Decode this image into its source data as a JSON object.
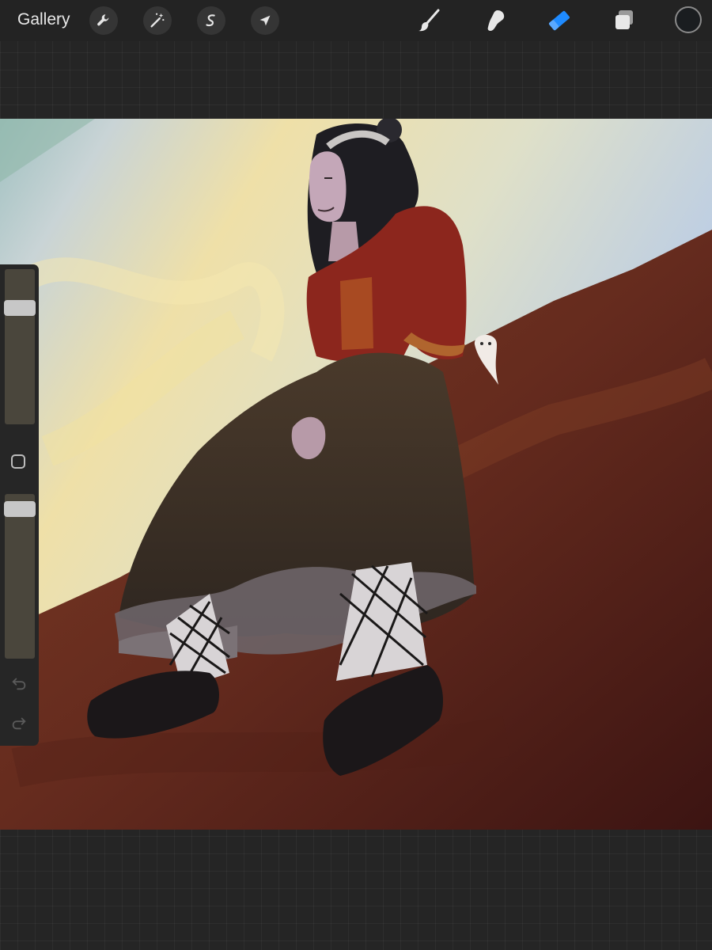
{
  "topbar": {
    "gallery_label": "Gallery",
    "actions": [
      "wrench-icon",
      "magic-wand-icon",
      "selection-icon",
      "transform-arrow-icon"
    ],
    "tools": [
      "brush-icon",
      "smudge-icon",
      "eraser-icon",
      "layers-icon"
    ],
    "active_tool": "eraser-icon",
    "active_color": "#1a1d20",
    "accent": "#1f8bff"
  },
  "sidebar": {
    "brush_size": 0.78,
    "opacity": 0.95,
    "buttons": [
      "modify-square-icon",
      "undo-icon",
      "redo-icon"
    ]
  },
  "canvas": {
    "sky_colors": [
      "#b7c8de",
      "#efe0a6"
    ],
    "ground_colors": [
      "#7a3a22",
      "#3e1612"
    ]
  }
}
